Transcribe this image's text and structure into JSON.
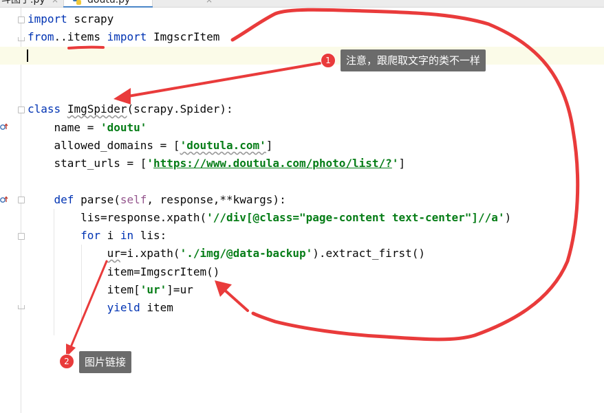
{
  "tabs": [
    {
      "label": "斗图子.py",
      "close": "×"
    },
    {
      "label": "doutu.py",
      "close": "×"
    }
  ],
  "code": {
    "l1": {
      "kw": "import",
      "rest": " scrapy"
    },
    "l2": {
      "kw1": "from",
      "dots": "..",
      "mod": "items",
      "sp": " ",
      "kw2": "import",
      "rest": " ImgscrItem"
    },
    "l5": {
      "kw": "class",
      "sp": " ",
      "cls": "ImgSpider",
      "rest": "(scrapy.Spider):"
    },
    "l6": {
      "pre": "    name = ",
      "str": "'doutu'"
    },
    "l7": {
      "pre": "    allowed_domains = [",
      "str": "'doutula.com'",
      "post": "]"
    },
    "l8": {
      "pre": "    start_urls = [",
      "q1": "'",
      "url": "https://www.doutula.com/photo/list/?",
      "q2": "'",
      "post": "]"
    },
    "l10": {
      "pre": "    ",
      "kw": "def",
      "sp": " parse(",
      "self": "self",
      "rest": ", response,**kwargs):"
    },
    "l11": {
      "pre": "        lis=response.xpath(",
      "str": "'//div[@class=\"page-content text-center\"]//a'",
      "post": ")"
    },
    "l12": {
      "pre": "        ",
      "kw1": "for",
      "mid": " i ",
      "kw2": "in",
      "rest": " lis:"
    },
    "l13": {
      "pre": "            ",
      "var": "ur",
      "mid": "=i.xpath(",
      "str": "'./img/@data-backup'",
      "post": ").extract_first()"
    },
    "l14": {
      "text": "            item=ImgscrItem()"
    },
    "l15": {
      "pre": "            item[",
      "str": "'ur'",
      "post": "]=ur"
    },
    "l16": {
      "pre": "            ",
      "kw": "yield",
      "rest": " item"
    }
  },
  "annotations": {
    "note1": {
      "badge": "1",
      "text": "注意，跟爬取文字的类不一样"
    },
    "note2": {
      "badge": "2",
      "text": "图片链接"
    },
    "color": "#e93b3b"
  }
}
